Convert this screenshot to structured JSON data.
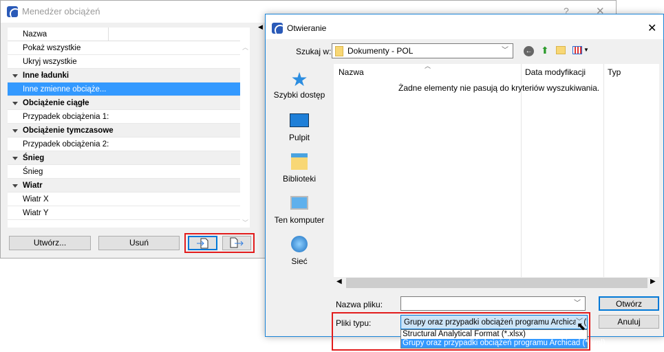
{
  "manager": {
    "title": "Menedżer obciążeń",
    "help": "?",
    "close": "✕",
    "column": "Nazwa",
    "rows": [
      {
        "label": "Pokaż wszystkie",
        "type": "item"
      },
      {
        "label": "Ukryj wszystkie",
        "type": "item"
      },
      {
        "label": "Inne ładunki",
        "type": "group"
      },
      {
        "label": "Inne zmienne obciąże...",
        "type": "selected"
      },
      {
        "label": "Obciążenie ciągłe",
        "type": "group"
      },
      {
        "label": "Przypadek obciążenia 1:",
        "type": "item"
      },
      {
        "label": "Obciążenie tymczasowe",
        "type": "group"
      },
      {
        "label": "Przypadek obciążenia 2:",
        "type": "item"
      },
      {
        "label": "Śnieg",
        "type": "group"
      },
      {
        "label": "Śnieg",
        "type": "item"
      },
      {
        "label": "Wiatr",
        "type": "group"
      },
      {
        "label": "Wiatr X",
        "type": "item"
      },
      {
        "label": "Wiatr Y",
        "type": "item"
      }
    ],
    "create_label": "Utwórz...",
    "delete_label": "Usuń"
  },
  "open": {
    "title": "Otwieranie",
    "close": "✕",
    "look_in_label": "Szukaj w:",
    "look_in_value": "Dokumenty - POL",
    "places": [
      "Szybki dostęp",
      "Pulpit",
      "Biblioteki",
      "Ten komputer",
      "Sieć"
    ],
    "columns": [
      "Nazwa",
      "Data modyfikacji",
      "Typ"
    ],
    "empty_message": "Żadne elementy nie pasują do kryteriów wyszukiwania.",
    "filename_label": "Nazwa pliku:",
    "filename_value": "",
    "filetype_label": "Pliki typu:",
    "filetype_value": "Grupy oraz przypadki obciążeń programu Archicad (*",
    "filetype_options": [
      "Structural Analytical Format (*.xlsx)",
      "Grupy oraz przypadki obciążeń programu Archicad (*.xml)"
    ],
    "open_label": "Otwórz",
    "cancel_label": "Anuluj"
  },
  "colors": {
    "accent": "#3399ff",
    "highlight": "#e21b1b"
  }
}
